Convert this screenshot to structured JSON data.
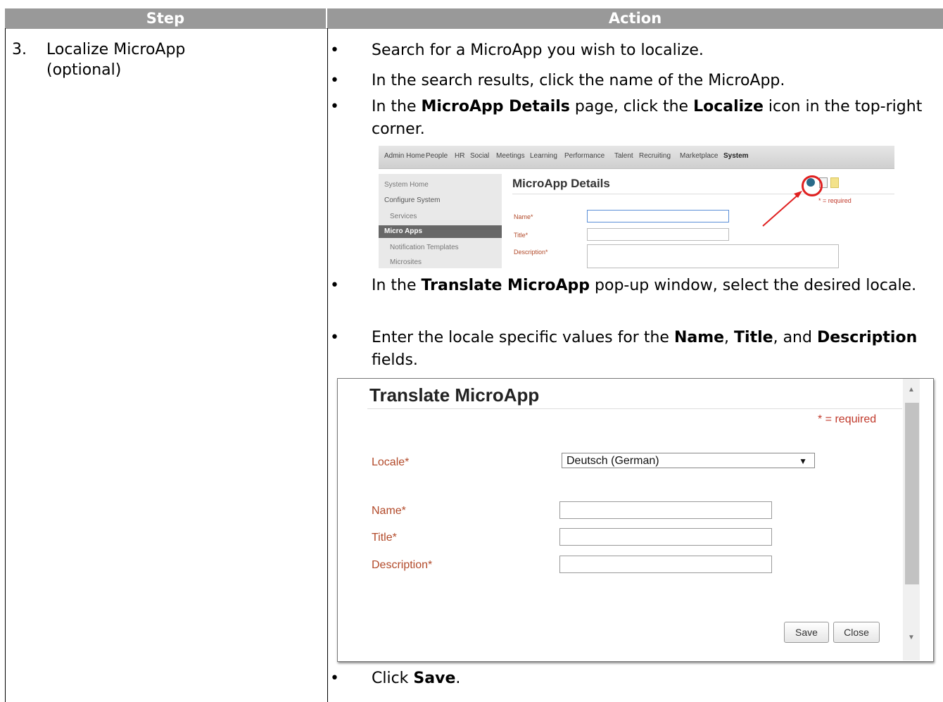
{
  "table": {
    "headers": {
      "step": "Step",
      "action": "Action"
    }
  },
  "step": {
    "number": "3.",
    "label_line1": "Localize MicroApp",
    "label_line2": "(optional)"
  },
  "actions": {
    "b1": "Search for a MicroApp you wish to localize.",
    "b2": "In the search results, click the name of the MicroApp.",
    "b3_pre": "In the ",
    "b3_bold1": "MicroApp Details",
    "b3_mid": " page, click the ",
    "b3_bold2": "Localize",
    "b3_post": " icon in the top-right corner.",
    "b4_pre": "In the ",
    "b4_bold": "Translate MicroApp",
    "b4_post": " pop-up window, select the desired locale.",
    "b5_pre": "Enter the locale specific values for the ",
    "b5_bold1": "Name",
    "b5_sep1": ", ",
    "b5_bold2": "Title",
    "b5_sep2": ", and ",
    "b5_bold3": "Description",
    "b5_post": " fields.",
    "b6_pre": "Click ",
    "b6_bold": "Save",
    "b6_post": ".",
    "bullet_glyph": "•"
  },
  "shot1": {
    "nav": [
      "Admin Home",
      "People",
      "HR",
      "Social",
      "Meetings",
      "Learning",
      "Performance",
      "Talent",
      "Recruiting",
      "Marketplace",
      "System"
    ],
    "sidebar": [
      "System Home",
      "Configure System",
      "Services",
      "Micro Apps",
      "Notification Templates",
      "Microsites"
    ],
    "title": "MicroApp Details",
    "required": "* = required",
    "labels": {
      "name": "Name*",
      "title": "Title*",
      "description": "Description*"
    },
    "icons": [
      "globe-icon",
      "document-icon",
      "note-icon"
    ]
  },
  "shot2": {
    "title": "Translate MicroApp",
    "required": "* = required",
    "locale_label": "Locale*",
    "locale_value": "Deutsch (German)",
    "name_label": "Name*",
    "title_label": "Title*",
    "description_label": "Description*",
    "save_label": "Save",
    "close_label": "Close"
  }
}
